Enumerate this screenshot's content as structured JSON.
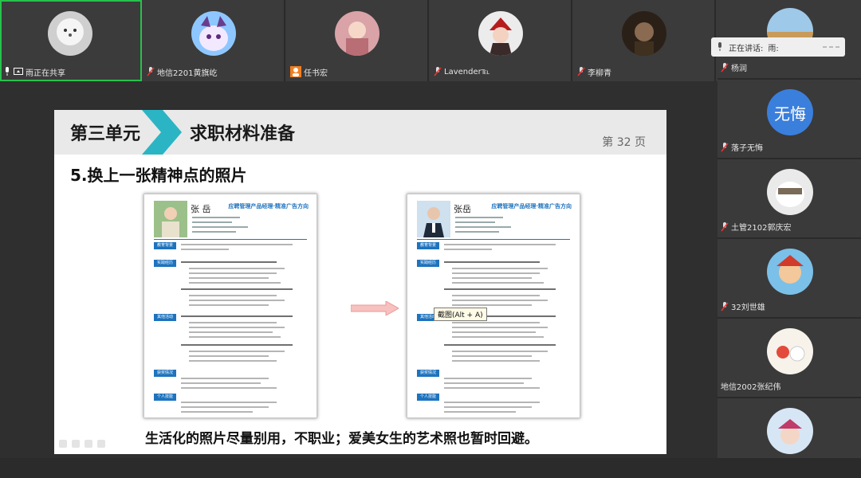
{
  "participants_top": [
    {
      "name": "雨正在共享",
      "active": true,
      "share_icon": "screen-share-icon"
    },
    {
      "name": "地信2201黄旗屹"
    },
    {
      "name": "任书宏"
    },
    {
      "name": "Lavender℡"
    },
    {
      "name": "李柳青"
    }
  ],
  "participants_right": [
    {
      "name": "杨润"
    },
    {
      "name": "落子无悔",
      "avatar_text": "无悔"
    },
    {
      "name": "土管2102郭庆宏"
    },
    {
      "name": "32刘世雄"
    },
    {
      "name": "地信2002张纪伟"
    }
  ],
  "speaking": {
    "label": "正在讲话:",
    "name": "雨:"
  },
  "slide": {
    "unit": "第三单元",
    "title": "求职材料准备",
    "page": "第 32 页",
    "subtitle": "5.换上一张精神点的照片",
    "caption": "生活化的照片尽量别用，不职业；爱美女生的艺术照也暂时回避。",
    "tooltip": "截图(Alt + A)",
    "resume_left": {
      "name": "张 岳",
      "job": "应聘管理产品经理·精准广告方向",
      "sections": [
        "教育背景",
        "实践经历",
        "其他活动",
        "获奖情况",
        "个人技能"
      ]
    },
    "resume_right": {
      "name": "张岳",
      "job": "应聘管理产品经理·精准广告方向",
      "sections": [
        "教育背景",
        "实践经历",
        "其他活动",
        "获奖情况",
        "个人技能"
      ]
    }
  },
  "colors": {
    "accent_teal": "#2bb5c4",
    "resume_blue": "#1e73be",
    "active_green": "#27c24c"
  }
}
